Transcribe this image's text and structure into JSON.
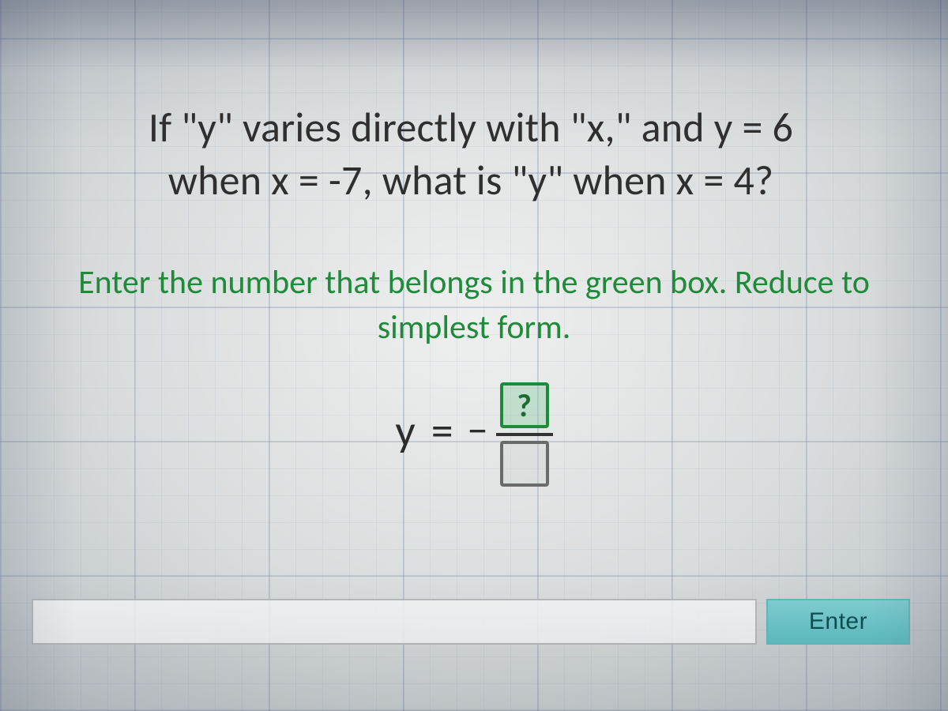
{
  "question": {
    "line1": "If \"y\" varies directly with \"x,\" and y = 6",
    "line2": "when x = -7, what is \"y\" when x = 4?"
  },
  "hint": {
    "line1": "Enter the number that belongs in the green box.",
    "line2": "Reduce to simplest form."
  },
  "formula": {
    "lhs": "y",
    "equals": "=",
    "negative": "−",
    "numerator_placeholder": "?",
    "denominator_placeholder": ""
  },
  "answer": {
    "value": "",
    "placeholder": ""
  },
  "buttons": {
    "enter": "Enter"
  },
  "colors": {
    "hint_green": "#1f8a3a",
    "box_green": "#1e8a3a",
    "enter_bg": "#6fc7ca"
  }
}
